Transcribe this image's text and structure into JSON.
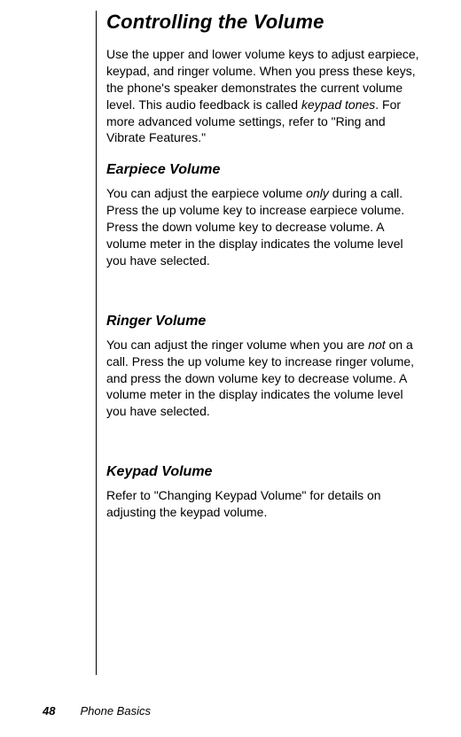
{
  "title": "Controlling the Volume",
  "intro_before_italic": "Use the upper and lower volume keys to adjust earpiece, keypad, and ringer volume. When you press these keys, the phone's speaker demonstrates the current volume level. This audio feedback is called ",
  "intro_italic": "keypad tones",
  "intro_after_italic": ". For more advanced volume settings, refer to \"Ring and Vibrate Features.\"",
  "sections": {
    "earpiece": {
      "heading": "Earpiece Volume",
      "before_italic": "You can adjust the earpiece volume ",
      "italic": "only",
      "after_italic": " during a call. Press the up volume key to increase earpiece volume. Press the down volume key to decrease volume. A volume meter in the display indicates the volume level you have selected."
    },
    "ringer": {
      "heading": "Ringer Volume",
      "before_italic": "You can adjust the ringer volume when you are ",
      "italic": "not",
      "after_italic": " on a call. Press the up volume key to increase ringer volume, and press the down volume key to decrease volume. A volume meter in the display indicates the volume level you have selected."
    },
    "keypad": {
      "heading": "Keypad Volume",
      "body": "Refer to \"Changing Keypad Volume\"  for details on adjusting the keypad volume."
    }
  },
  "footer": {
    "page_number": "48",
    "section_name": "Phone Basics"
  }
}
